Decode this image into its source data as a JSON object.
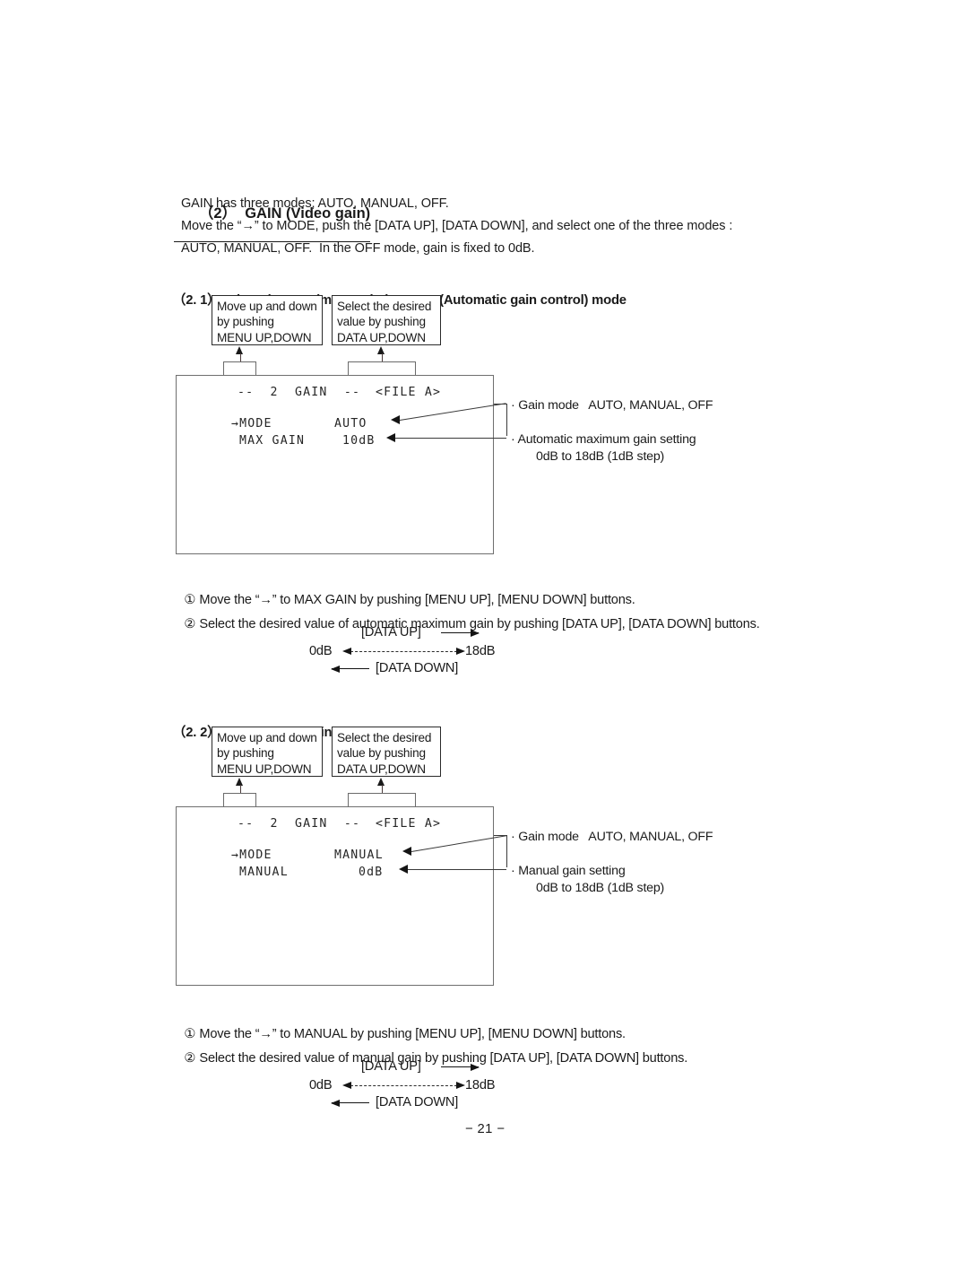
{
  "document": {
    "page_number": "− 21 −"
  },
  "section": {
    "number": "（2）",
    "title": "GAIN (Video gain)",
    "intro_lines": [
      "GAIN has three modes; AUTO, MANUAL, OFF.",
      "Move the “→” to MODE, push the [DATA UP], [DATA DOWN], and select one of the three modes :",
      "AUTO, MANUAL, OFF.  In the OFF mode, gain is fixed to 0dB."
    ]
  },
  "subsection_auto": {
    "number": "（2. 1）",
    "title": "Changing maximum gain in AUTO (Automatic gain control) mode",
    "callout_left": {
      "line1": "Move up and down",
      "line2": "by pushing",
      "line3": "MENU UP,DOWN"
    },
    "callout_right": {
      "line1": "Select the desired",
      "line2": "value by pushing",
      "line3": "DATA UP,DOWN"
    },
    "osd": {
      "title_left": "--  2  GAIN  --",
      "title_right": "<FILE A>",
      "row1_label": "→MODE",
      "row1_value": "AUTO",
      "row2_label": "MAX GAIN",
      "row2_value": "10dB"
    },
    "annotations": [
      {
        "line1": "· Gain mode   AUTO, MANUAL, OFF",
        "line2": ""
      },
      {
        "line1": "· Automatic maximum gain setting",
        "line2": "0dB to 18dB (1dB step)"
      }
    ],
    "steps": [
      {
        "num": "①",
        "text": "Move the “→” to MAX GAIN by pushing [MENU UP], [MENU DOWN] buttons."
      },
      {
        "num": "②",
        "text": "Select the desired value of automatic maximum gain by pushing [DATA UP], [DATA DOWN] buttons."
      }
    ],
    "range": {
      "up_label": "[DATA UP]",
      "down_label": "[DATA DOWN]",
      "min": "0dB",
      "max": "18dB"
    }
  },
  "subsection_manual": {
    "number": "（2. 2）",
    "title": "Changing gain in MANUAL mode",
    "callout_left": {
      "line1": "Move up and down",
      "line2": "by pushing",
      "line3": "MENU UP,DOWN"
    },
    "callout_right": {
      "line1": "Select the desired",
      "line2": "value by pushing",
      "line3": "DATA UP,DOWN"
    },
    "osd": {
      "title_left": "--  2  GAIN  --",
      "title_right": "<FILE A>",
      "row1_label": "→MODE",
      "row1_value": "MANUAL",
      "row2_label": "MANUAL",
      "row2_value": "0dB"
    },
    "annotations": [
      {
        "line1": "· Gain mode   AUTO, MANUAL, OFF",
        "line2": ""
      },
      {
        "line1": "· Manual gain setting",
        "line2": "0dB to 18dB (1dB step)"
      }
    ],
    "steps": [
      {
        "num": "①",
        "text": "Move the “→” to MANUAL by pushing [MENU UP], [MENU DOWN] buttons."
      },
      {
        "num": "②",
        "text": "Select the desired value of manual gain by pushing [DATA UP], [DATA DOWN] buttons."
      }
    ],
    "range": {
      "up_label": "[DATA UP]",
      "down_label": "[DATA DOWN]",
      "min": "0dB",
      "max": "18dB"
    }
  }
}
